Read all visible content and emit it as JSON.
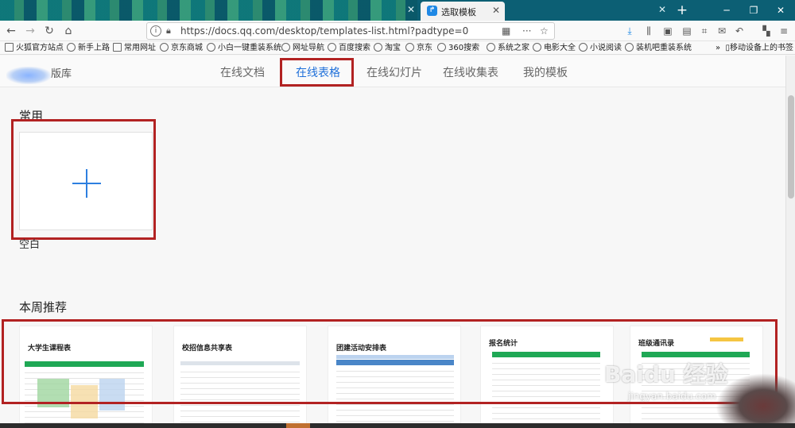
{
  "browser": {
    "active_tab_title": "选取模板",
    "other_tab_title": "",
    "url": "https://docs.qq.com/desktop/templates-list.html?padtype=0",
    "bookmarks": [
      "火狐官方站点",
      "新手上路",
      "常用网址",
      "京东商城",
      "小白一键重装系统",
      "网址导航",
      "百度搜索",
      "淘宝",
      "京东",
      "360搜索",
      "系统之家",
      "电影大全",
      "小说阅读",
      "装机吧重装系统"
    ],
    "mobile_bookmarks": "移动设备上的书签"
  },
  "header": {
    "library_title": "版库",
    "tabs": [
      "在线文档",
      "在线表格",
      "在线幻灯片",
      "在线收集表",
      "我的模板"
    ],
    "active_tab_index": 1
  },
  "common": {
    "title": "常用",
    "blank_label": "空白"
  },
  "weekly": {
    "title": "本周推荐",
    "templates": [
      "大学生课程表",
      "校招信息共享表",
      "团建活动安排表",
      "报名统计",
      "班级通讯录"
    ]
  },
  "watermark": {
    "text": "Baidu 经验",
    "url": "jingyan.baidu.com"
  },
  "colors": {
    "accent": "#1e6fd9",
    "highlight_box": "#b22222",
    "sheet_green": "#1fa855",
    "sheet_blue": "#4a86c8"
  }
}
